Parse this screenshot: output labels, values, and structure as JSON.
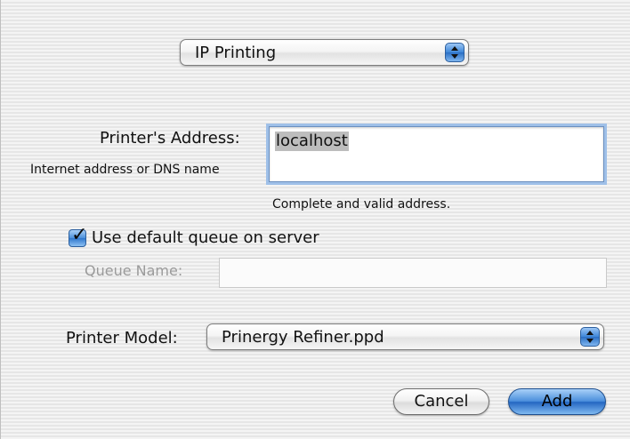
{
  "connection_type": {
    "selected": "IP Printing"
  },
  "address": {
    "label": "Printer's Address:",
    "hint": "Internet address or DNS name",
    "value": "localhost",
    "status": "Complete and valid address."
  },
  "queue": {
    "default_queue_label": "Use default queue on server",
    "default_queue_checked": true,
    "queue_name_label": "Queue Name:",
    "queue_name_value": ""
  },
  "model": {
    "label": "Printer Model:",
    "selected": "Prinergy Refiner.ppd"
  },
  "buttons": {
    "cancel_label": "Cancel",
    "add_label": "Add"
  },
  "colors": {
    "accent_blue": "#3d86d8",
    "disabled_text": "#9a9a9a"
  }
}
